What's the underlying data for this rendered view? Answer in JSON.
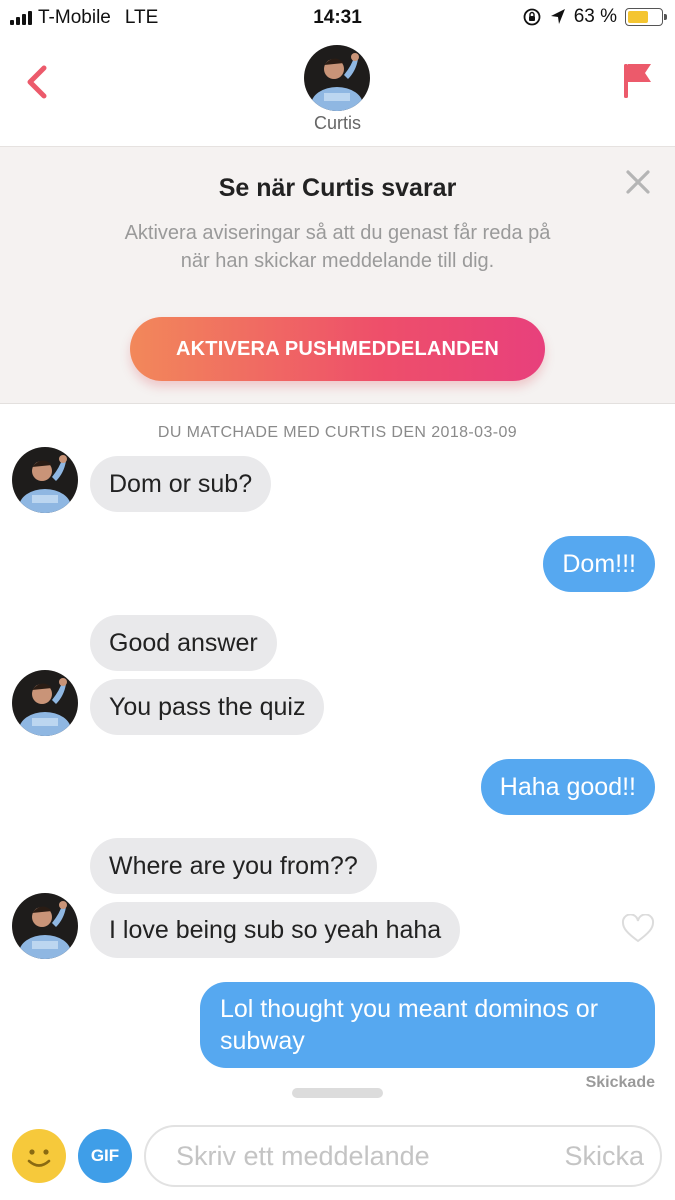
{
  "status_bar": {
    "carrier": "T-Mobile",
    "network": "LTE",
    "time": "14:31",
    "battery_percent": "63 %",
    "battery_level": 0.63,
    "icons": [
      "signal-icon",
      "rotation-lock-icon",
      "location-arrow-icon",
      "battery-icon"
    ]
  },
  "header": {
    "contact_name": "Curtis",
    "back_icon": "chevron-left-icon",
    "report_icon": "flag-icon",
    "accent_color": "#ec5a6b"
  },
  "banner": {
    "title": "Se när Curtis svarar",
    "text": "Aktivera aviseringar så att du genast får reda på när han skickar meddelande till dig.",
    "button_label": "AKTIVERA PUSHMEDDELANDEN",
    "close_icon": "close-icon"
  },
  "chat": {
    "match_note": "DU MATCHADE MED CURTIS DEN 2018-03-09",
    "messages": [
      {
        "from": "them",
        "text": "Dom or sub?"
      },
      {
        "from": "me",
        "text": "Dom!!!"
      },
      {
        "from": "them",
        "text": "Good answer"
      },
      {
        "from": "them",
        "text": "You pass the quiz"
      },
      {
        "from": "me",
        "text": "Haha good!!"
      },
      {
        "from": "them",
        "text": "Where are you from??"
      },
      {
        "from": "them",
        "text": "I love being sub so yeah haha"
      },
      {
        "from": "me",
        "text": "Lol thought you meant dominos or subway"
      }
    ],
    "sent_status": "Skickade",
    "like_icon": "heart-outline-icon",
    "bubble_colors": {
      "incoming": "#e9e9eb",
      "outgoing": "#56a8f0"
    }
  },
  "compose": {
    "emoji_icon": "smiley-icon",
    "gif_label": "GIF",
    "placeholder": "Skriv ett meddelande",
    "value": "",
    "send_label": "Skicka"
  }
}
